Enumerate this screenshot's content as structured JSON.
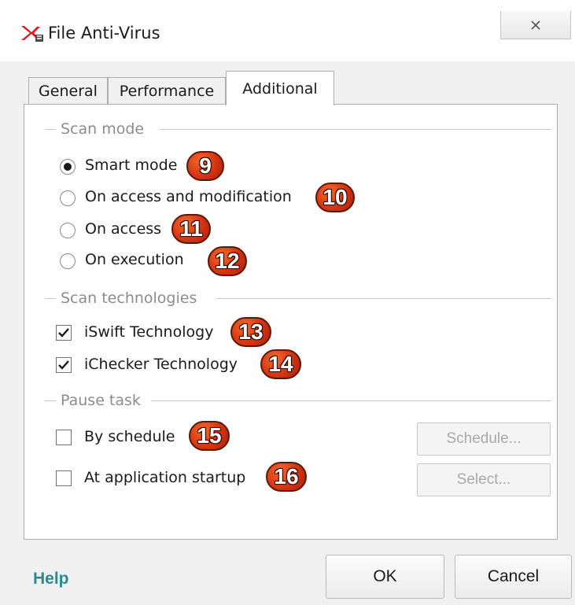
{
  "window": {
    "title": "File Anti-Virus",
    "close_symbol": "×",
    "logo_icon": "kaspersky-logo-icon"
  },
  "tabs": [
    {
      "label": "General",
      "active": false
    },
    {
      "label": "Performance",
      "active": false
    },
    {
      "label": "Additional",
      "active": true
    }
  ],
  "scan_mode": {
    "title": "Scan mode",
    "options": [
      {
        "label": "Smart mode",
        "selected": true,
        "badge": "9"
      },
      {
        "label": "On access and modification",
        "selected": false,
        "badge": "10"
      },
      {
        "label": "On access",
        "selected": false,
        "badge": "11"
      },
      {
        "label": "On execution",
        "selected": false,
        "badge": "12"
      }
    ]
  },
  "scan_technologies": {
    "title": "Scan technologies",
    "options": [
      {
        "label": "iSwift Technology",
        "checked": true,
        "badge": "13"
      },
      {
        "label": "iChecker Technology",
        "checked": true,
        "badge": "14"
      }
    ]
  },
  "pause_task": {
    "title": "Pause task",
    "options": [
      {
        "label": "By schedule",
        "checked": false,
        "badge": "15",
        "button": "Schedule..."
      },
      {
        "label": "At application startup",
        "checked": false,
        "badge": "16",
        "button": "Select..."
      }
    ]
  },
  "footer": {
    "help": "Help",
    "ok": "OK",
    "cancel": "Cancel"
  },
  "colors": {
    "badge": "#d63412",
    "help_link": "#2a8a8c",
    "disabled_text": "#a8a8a8"
  }
}
